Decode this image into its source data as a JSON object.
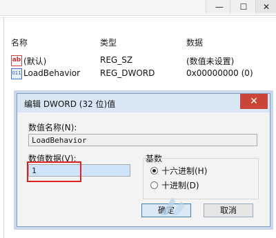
{
  "window": {
    "min_glyph": "—",
    "max_glyph": "☐",
    "close_glyph": "✕"
  },
  "list": {
    "headers": [
      "名称",
      "类型",
      "数据"
    ],
    "rows": [
      {
        "icon": "ab",
        "name": "(默认)",
        "type": "REG_SZ",
        "data": "(数值未设置)"
      },
      {
        "icon": "bin",
        "name": "LoadBehavior",
        "type": "REG_DWORD",
        "data": "0x00000000 (0)"
      }
    ]
  },
  "dialog": {
    "title": "编辑 DWORD (32 位)值",
    "close_glyph": "✕",
    "name_label": "数值名称(N):",
    "name_value": "LoadBehavior",
    "data_label": "数值数据(V):",
    "data_value": "1",
    "radix_label": "基数",
    "radix_options": [
      {
        "label": "十六进制(H)",
        "checked": true
      },
      {
        "label": "十进制(D)",
        "checked": false
      }
    ],
    "ok_label": "确定",
    "cancel_label": "取消"
  },
  "colors": {
    "highlight": "#e02020",
    "dialog_close": "#c84538"
  }
}
